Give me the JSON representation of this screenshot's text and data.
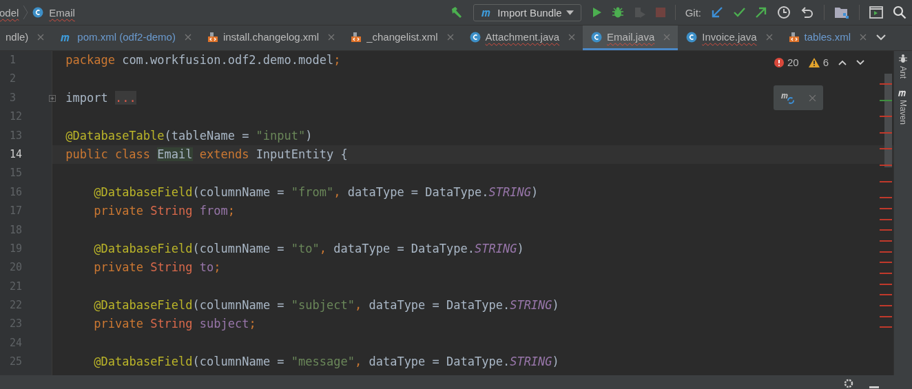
{
  "breadcrumb": [
    {
      "label": "odel",
      "kind": "package",
      "error": true
    },
    {
      "label": "Email",
      "kind": "class",
      "error": true
    }
  ],
  "toolbar": {
    "config": {
      "label": "Import Bundle"
    },
    "git_label": "Git:",
    "coverage_disabled": true,
    "stop_disabled": true
  },
  "tabs": [
    {
      "label": "ndle)",
      "kind": "cut",
      "selected": false,
      "modified": false,
      "error": false
    },
    {
      "label": "pom.xml (odf2-demo)",
      "kind": "maven",
      "selected": false,
      "modified": true,
      "error": false
    },
    {
      "label": "install.changelog.xml",
      "kind": "xml",
      "selected": false,
      "modified": false,
      "error": false
    },
    {
      "label": "_changelist.xml",
      "kind": "xml",
      "selected": false,
      "modified": false,
      "error": false
    },
    {
      "label": "Attachment.java",
      "kind": "class",
      "selected": false,
      "modified": false,
      "error": true
    },
    {
      "label": "Email.java",
      "kind": "class",
      "selected": true,
      "modified": false,
      "error": true
    },
    {
      "label": "Invoice.java",
      "kind": "class",
      "selected": false,
      "modified": false,
      "error": true
    },
    {
      "label": "tables.xml",
      "kind": "xml",
      "selected": false,
      "modified": true,
      "error": false
    }
  ],
  "inspections": {
    "errors": "20",
    "warnings": "6"
  },
  "side_tools": [
    {
      "label": "Ant",
      "kind": "ant"
    },
    {
      "label": "Maven",
      "kind": "maven"
    }
  ],
  "lines": [
    {
      "number": "1",
      "current": false,
      "tokens": [
        {
          "kind": "keyword",
          "text": "package "
        },
        {
          "kind": "plain",
          "text": "com.workfusion.odf2.demo.model"
        },
        {
          "kind": "keyword",
          "text": ";"
        }
      ]
    },
    {
      "number": "2",
      "current": false
    },
    {
      "number": "3",
      "current": false,
      "folded": true,
      "tokens": [
        {
          "kind": "plain",
          "text": "import "
        },
        {
          "kind": "folded",
          "text": "..."
        }
      ]
    },
    {
      "number": "12",
      "current": false
    },
    {
      "number": "13",
      "current": false,
      "tokens": [
        {
          "kind": "annotation",
          "text": "@DatabaseTable"
        },
        {
          "kind": "plain",
          "text": "(tableName = "
        },
        {
          "kind": "string",
          "text": "\"input\""
        },
        {
          "kind": "plain",
          "text": ")"
        }
      ]
    },
    {
      "number": "14",
      "current": true,
      "tokens": [
        {
          "kind": "keyword",
          "text": "public class "
        },
        {
          "kind": "usage",
          "text": "Email"
        },
        {
          "kind": "keyword",
          "text": " extends "
        },
        {
          "kind": "plain",
          "text": "InputEntity {"
        }
      ],
      "children": [
        {
          "number": "15",
          "current": false
        },
        {
          "number": "16",
          "current": false,
          "tokens": [
            {
              "kind": "annotation",
              "text": "@DatabaseField"
            },
            {
              "kind": "plain",
              "text": "(columnName = "
            },
            {
              "kind": "string",
              "text": "\"from\""
            },
            {
              "kind": "keyword",
              "text": ", "
            },
            {
              "kind": "plain",
              "text": "dataType = DataType."
            },
            {
              "kind": "constant",
              "text": "STRING"
            },
            {
              "kind": "plain",
              "text": ")"
            }
          ]
        },
        {
          "number": "17",
          "current": false,
          "tokens": [
            {
              "kind": "keyword",
              "text": "private "
            },
            {
              "kind": "errortype",
              "text": "String "
            },
            {
              "kind": "field",
              "text": "from"
            },
            {
              "kind": "keyword",
              "text": ";"
            }
          ]
        },
        {
          "number": "18",
          "current": false
        },
        {
          "number": "19",
          "current": false,
          "tokens": [
            {
              "kind": "annotation",
              "text": "@DatabaseField"
            },
            {
              "kind": "plain",
              "text": "(columnName = "
            },
            {
              "kind": "string",
              "text": "\"to\""
            },
            {
              "kind": "keyword",
              "text": ", "
            },
            {
              "kind": "plain",
              "text": "dataType = DataType."
            },
            {
              "kind": "constant",
              "text": "STRING"
            },
            {
              "kind": "plain",
              "text": ")"
            }
          ]
        },
        {
          "number": "20",
          "current": false,
          "tokens": [
            {
              "kind": "keyword",
              "text": "private "
            },
            {
              "kind": "errortype",
              "text": "String "
            },
            {
              "kind": "field",
              "text": "to"
            },
            {
              "kind": "keyword",
              "text": ";"
            }
          ]
        },
        {
          "number": "21",
          "current": false
        },
        {
          "number": "22",
          "current": false,
          "tokens": [
            {
              "kind": "annotation",
              "text": "@DatabaseField"
            },
            {
              "kind": "plain",
              "text": "(columnName = "
            },
            {
              "kind": "string",
              "text": "\"subject\""
            },
            {
              "kind": "keyword",
              "text": ", "
            },
            {
              "kind": "plain",
              "text": "dataType = DataType."
            },
            {
              "kind": "constant",
              "text": "STRING"
            },
            {
              "kind": "plain",
              "text": ")"
            }
          ]
        },
        {
          "number": "23",
          "current": false,
          "tokens": [
            {
              "kind": "keyword",
              "text": "private "
            },
            {
              "kind": "errortype",
              "text": "String "
            },
            {
              "kind": "field",
              "text": "subject"
            },
            {
              "kind": "keyword",
              "text": ";"
            }
          ]
        },
        {
          "number": "24",
          "current": false
        },
        {
          "number": "25",
          "current": false,
          "tokens": [
            {
              "kind": "annotation",
              "text": "@DatabaseField"
            },
            {
              "kind": "plain",
              "text": "(columnName = "
            },
            {
              "kind": "string",
              "text": "\"message\""
            },
            {
              "kind": "keyword",
              "text": ", "
            },
            {
              "kind": "plain",
              "text": "dataType = DataType."
            },
            {
              "kind": "constant",
              "text": "STRING"
            },
            {
              "kind": "plain",
              "text": ")"
            }
          ]
        }
      ]
    }
  ],
  "error_stripe": [
    {
      "color": "#c0392b"
    },
    {
      "color": "#3f8f3f"
    },
    {
      "color": "#c0392b"
    },
    {
      "color": "#c0392b"
    },
    {
      "color": "#c0392b"
    },
    {
      "color": "#c0392b"
    },
    {
      "color": "#c0392b"
    },
    {
      "color": "#c0392b"
    },
    {
      "color": "#c0392b"
    },
    {
      "color": "#c0392b"
    },
    {
      "color": "#c0392b"
    },
    {
      "color": "#c0392b"
    },
    {
      "color": "#c0392b"
    },
    {
      "color": "#c0392b"
    },
    {
      "color": "#c0392b"
    },
    {
      "color": "#c0392b"
    },
    {
      "color": "#c0392b"
    },
    {
      "color": "#c0392b"
    },
    {
      "color": "#c0392b"
    },
    {
      "color": "#c0392b"
    }
  ]
}
